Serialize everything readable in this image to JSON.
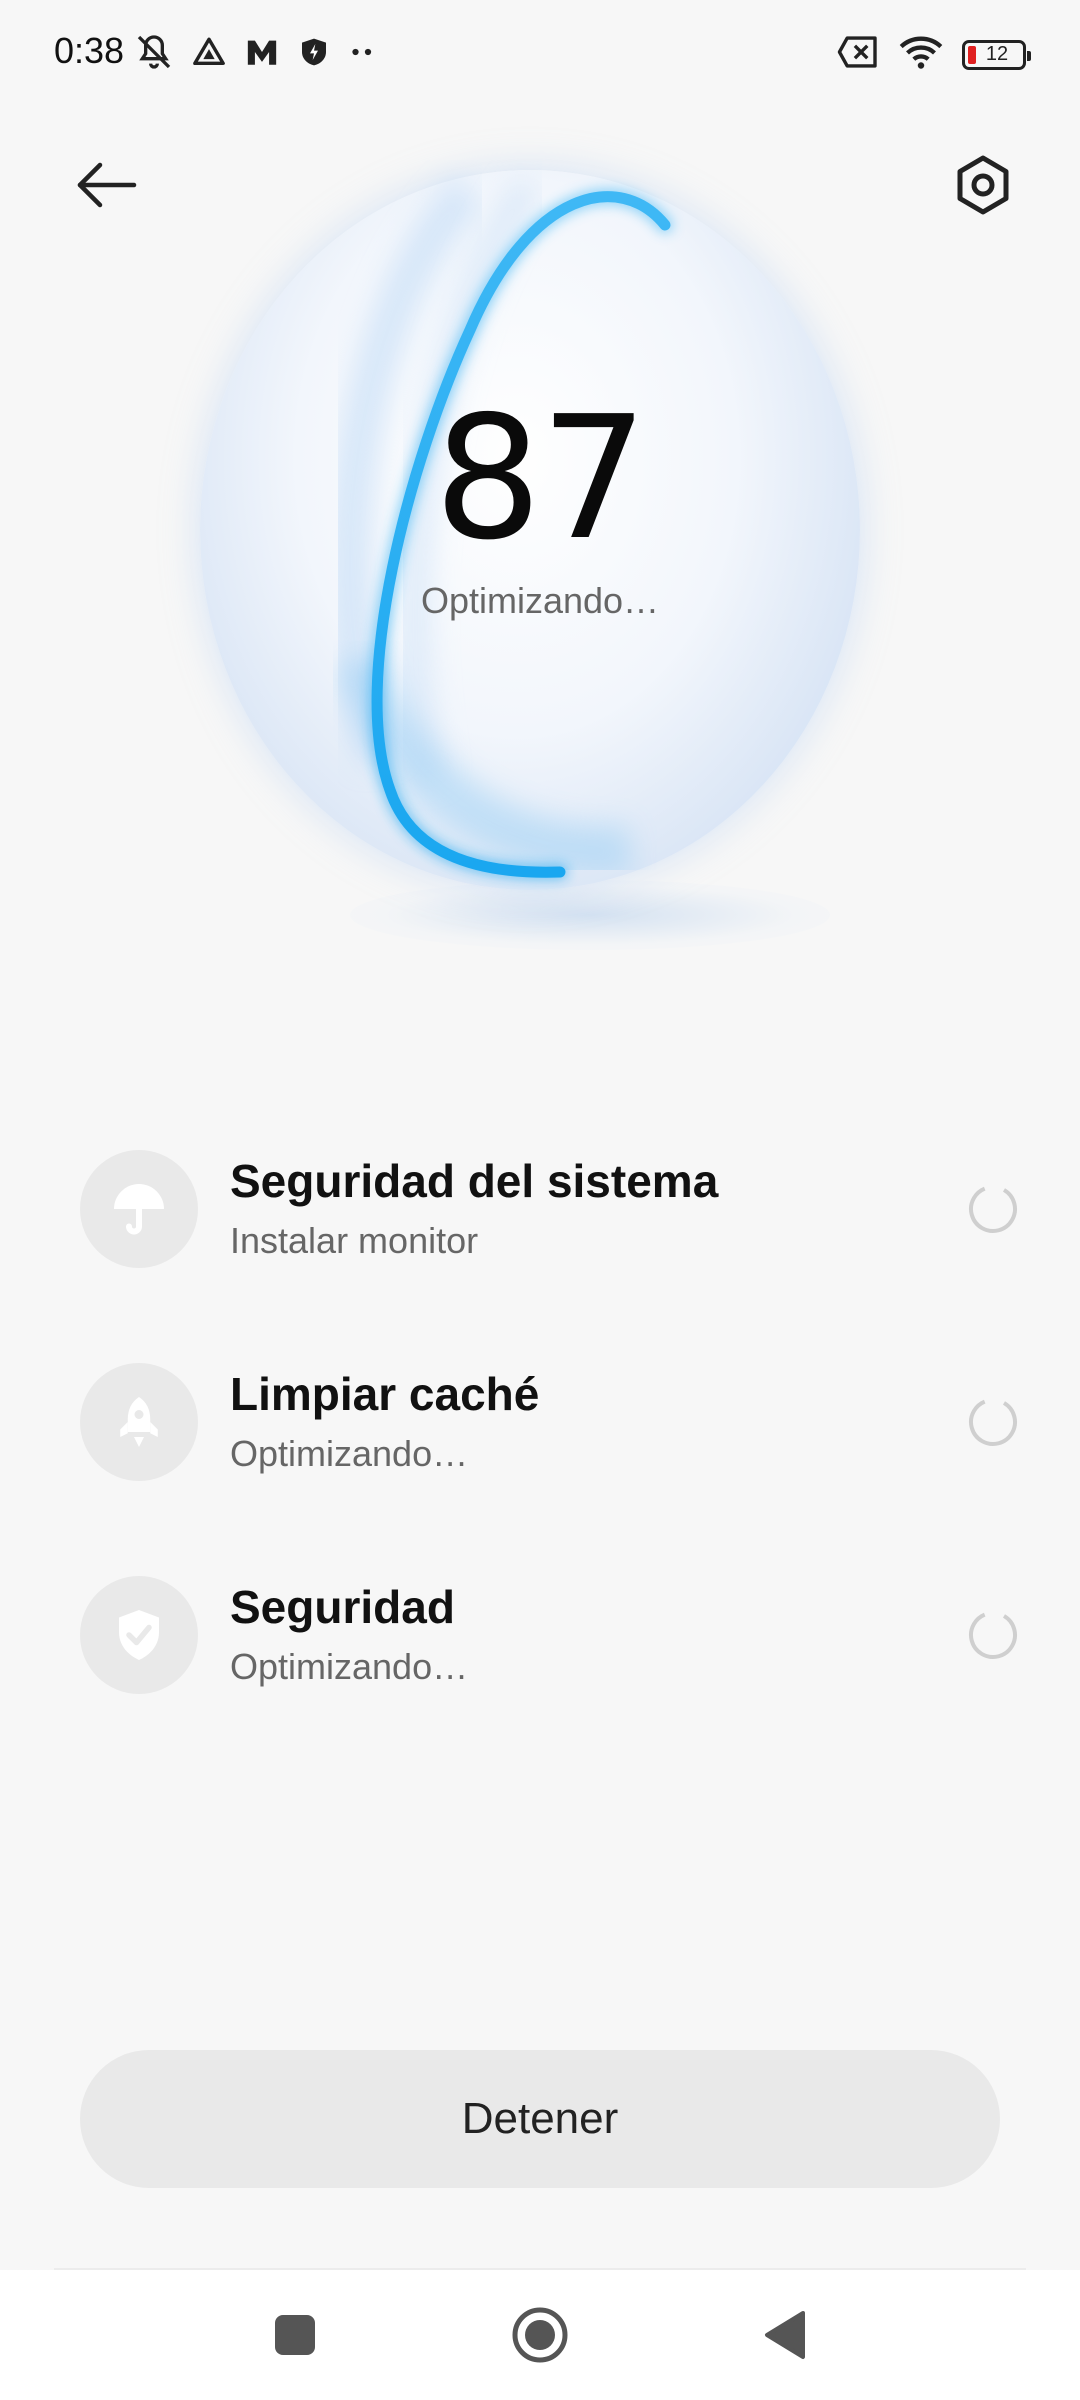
{
  "status_bar": {
    "time": "0:38",
    "battery_level": "12",
    "left_icons": [
      "bell-off-icon",
      "triangle-app-icon",
      "m-app-icon",
      "shield-bolt-icon",
      "more-dots-icon"
    ],
    "right_icons": [
      "sim-x-icon",
      "wifi-icon",
      "battery-icon"
    ]
  },
  "header": {
    "back_icon": "arrow-left-icon",
    "settings_icon": "hexagon-gear-icon"
  },
  "score": {
    "value": "87",
    "status": "Optimizando…"
  },
  "tasks": [
    {
      "title": "Seguridad del sistema",
      "subtitle": "Instalar monitor",
      "icon": "umbrella-icon",
      "state": "loading"
    },
    {
      "title": "Limpiar caché",
      "subtitle": "Optimizando…",
      "icon": "rocket-icon",
      "state": "loading"
    },
    {
      "title": "Seguridad",
      "subtitle": "Optimizando…",
      "icon": "shield-check-icon",
      "state": "loading"
    }
  ],
  "stop_button": {
    "label": "Detener"
  },
  "nav": {
    "recents_icon": "square-icon",
    "home_icon": "circle-icon",
    "back_icon": "triangle-back-icon"
  },
  "colors": {
    "accent_ring": "#1aa7f0",
    "background": "#f7f7f7",
    "icon_bg": "#e9e9e9",
    "battery_low": "#e02020"
  }
}
